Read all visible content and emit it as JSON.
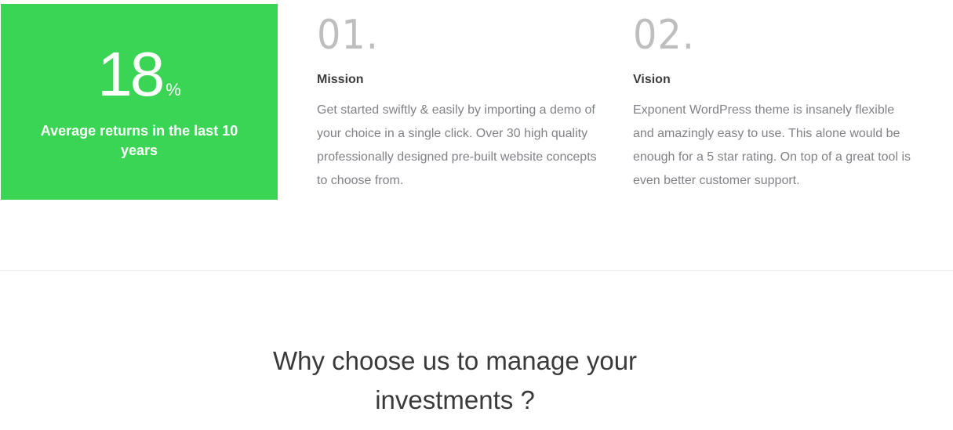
{
  "stat": {
    "value": "18",
    "unit": "%",
    "caption": "Average returns in the last 10 years",
    "background_color": "#3ad554"
  },
  "columns": [
    {
      "index": "01.",
      "title": "Mission",
      "body": "Get started swiftly & easily by importing a demo of your choice in a single click. Over 30 high quality professionally designed pre-built website concepts to choose from."
    },
    {
      "index": "02.",
      "title": "Vision",
      "body": "Exponent WordPress theme is insanely flexible and amazingly easy to use. This alone would be enough for a 5 star rating. On top of a great tool is even better customer support."
    }
  ],
  "section": {
    "heading": "Why choose us to manage your investments ?"
  }
}
